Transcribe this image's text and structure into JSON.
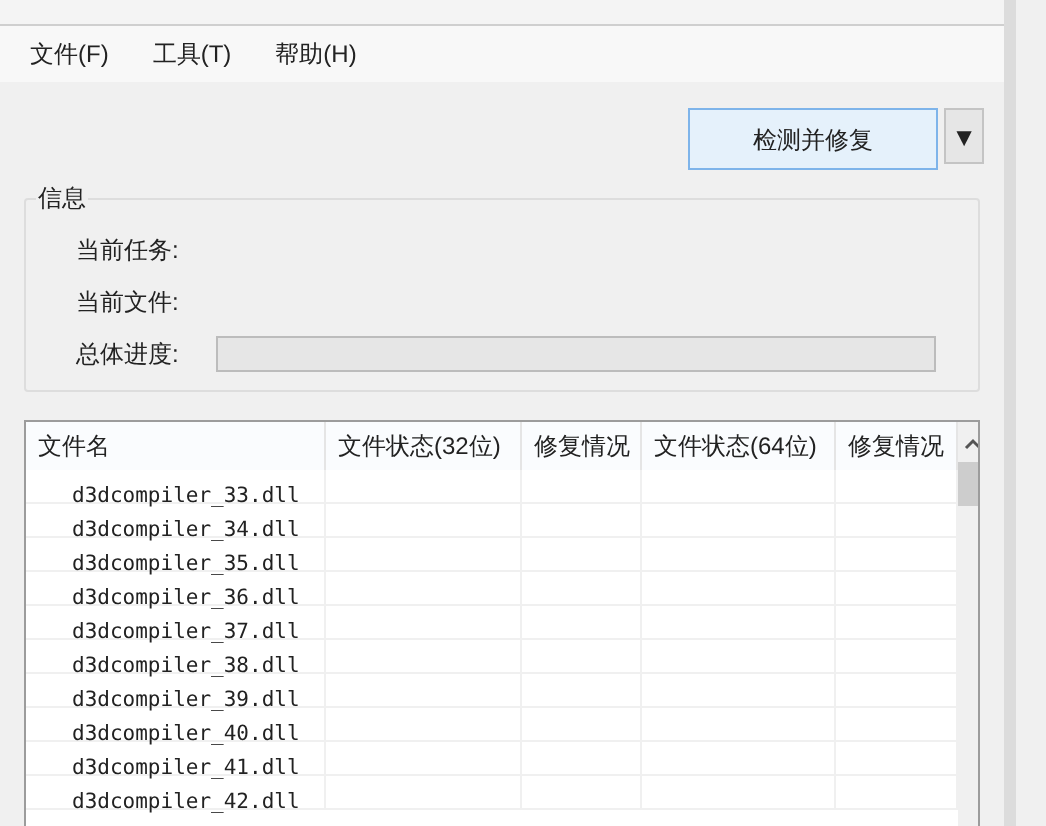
{
  "menu": [
    "文件(F)",
    "工具(T)",
    "帮助(H)"
  ],
  "action_button": "检测并修复",
  "dropdown_button": "▼",
  "info_group": {
    "title": "信息",
    "fields": [
      {
        "kind": "text",
        "label": "当前任务:"
      },
      {
        "kind": "text",
        "label": "当前文件:"
      },
      {
        "kind": "progress",
        "label": "总体进度:",
        "level": 0
      }
    ]
  },
  "table": {
    "columns": [
      "文件名",
      "文件状态(32位)",
      "修复情况",
      "文件状态(64位)",
      "修复情况"
    ],
    "rows": [
      "d3dcompiler_33.dll",
      "d3dcompiler_34.dll",
      "d3dcompiler_35.dll",
      "d3dcompiler_36.dll",
      "d3dcompiler_37.dll",
      "d3dcompiler_38.dll",
      "d3dcompiler_39.dll",
      "d3dcompiler_40.dll",
      "d3dcompiler_41.dll",
      "d3dcompiler_42.dll"
    ]
  }
}
